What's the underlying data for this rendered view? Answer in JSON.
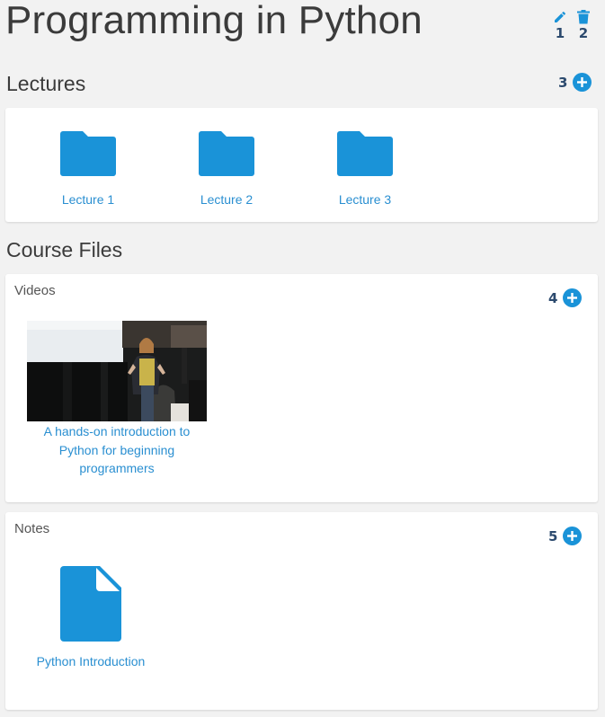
{
  "course": {
    "title": "Programming in Python"
  },
  "top_actions": {
    "edit": {
      "icon": "pencil-icon",
      "number": "1"
    },
    "delete": {
      "icon": "trash-icon",
      "number": "2"
    }
  },
  "lectures": {
    "section_title": "Lectures",
    "add_number": "3",
    "add_icon": "plus-circle-icon",
    "items": [
      {
        "label": "Lecture 1",
        "icon": "folder-icon"
      },
      {
        "label": "Lecture 2",
        "icon": "folder-icon"
      },
      {
        "label": "Lecture 3",
        "icon": "folder-icon"
      }
    ]
  },
  "course_files": {
    "section_title": "Course Files",
    "videos": {
      "heading": "Videos",
      "add_number": "4",
      "add_icon": "plus-circle-icon",
      "items": [
        {
          "caption": "A hands-on introduction to Python for beginning programmers",
          "thumbnail": "video-thumbnail"
        }
      ]
    },
    "notes": {
      "heading": "Notes",
      "add_number": "5",
      "add_icon": "plus-circle-icon",
      "items": [
        {
          "label": "Python Introduction",
          "icon": "document-icon"
        }
      ]
    }
  },
  "colors": {
    "accent": "#1a93d8",
    "link": "#2a8fd1",
    "number_label": "#2c4a6e",
    "background": "#f2f2f2",
    "card": "#ffffff"
  }
}
